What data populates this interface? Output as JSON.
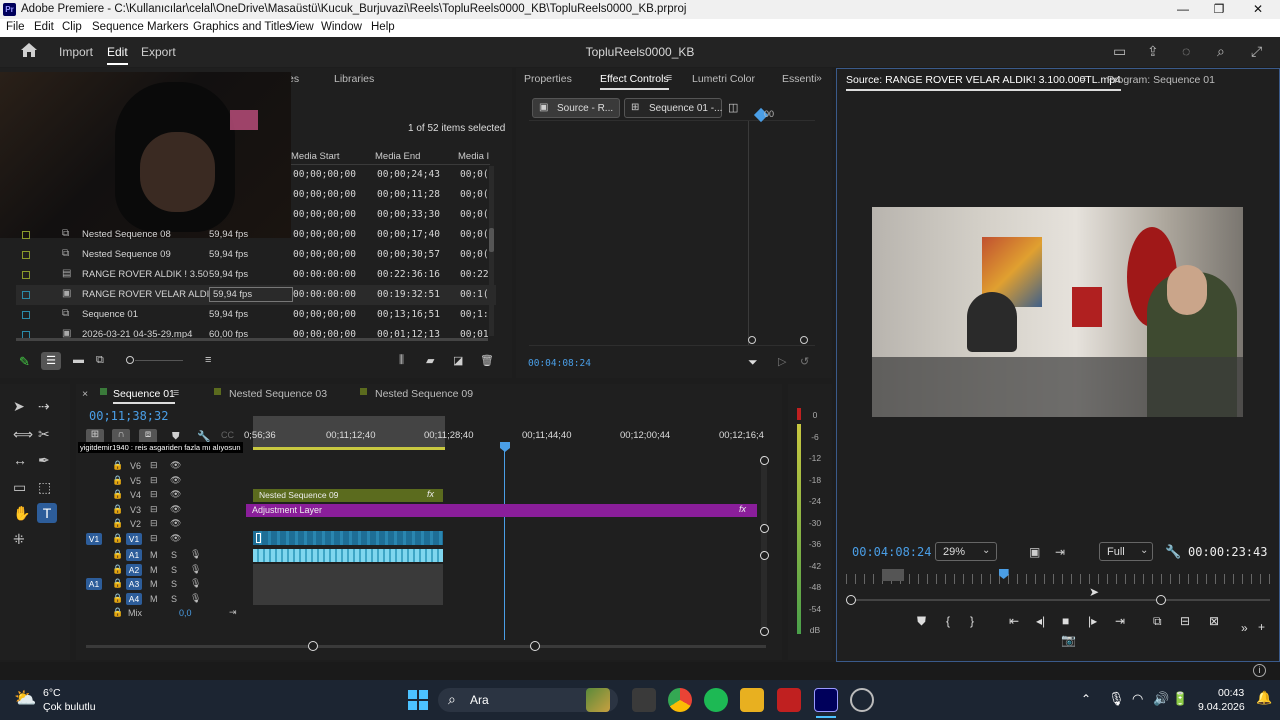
{
  "window": {
    "title": "Adobe Premiere - C:\\Kullanıcılar\\celal\\OneDrive\\Masaüstü\\Kucuk_Burjuvazi\\Reels\\TopluReels0000_KB\\TopluReels0000_KB.prproj",
    "app_badge": "Pr",
    "minimize": "—",
    "maximize": "❐",
    "close": "✕"
  },
  "menu": [
    "File",
    "Edit",
    "Clip",
    "Sequence",
    "Markers",
    "Graphics and Titles",
    "View",
    "Window",
    "Help"
  ],
  "header": {
    "import": "Import",
    "edit": "Edit",
    "export": "Export",
    "project_name": "TopluReels0000_KB"
  },
  "project_panel": {
    "tabs_partial": "es",
    "libraries_tab": "Libraries",
    "selection_info": "1 of 52 items selected",
    "columns": [
      "Media Start",
      "Media End",
      "Media I"
    ],
    "top_rows": [
      {
        "start": "00;00;00;00",
        "end": "00;00;24;43",
        "dur": "00;0("
      },
      {
        "start": "00;00;00;00",
        "end": "00;00;11;28",
        "dur": "00;0("
      },
      {
        "start": "00;00;00;00",
        "end": "00;00;33;30",
        "dur": "00;0("
      },
      {
        "start": "00;00;00;00",
        "end": "00;00;17;40",
        "dur": "00;0("
      }
    ],
    "items": [
      {
        "name": "Nested Sequence 08",
        "fps": "59,94 fps",
        "start": "00;00;00;00",
        "end": "00;00;17;40",
        "dur": "00;0(",
        "color": "#8a9a2a",
        "type": "seq"
      },
      {
        "name": "Nested Sequence 09",
        "fps": "59,94 fps",
        "start": "00;00;00;00",
        "end": "00;00;30;57",
        "dur": "00;0(",
        "color": "#8a9a2a",
        "type": "seq"
      },
      {
        "name": "RANGE ROVER ALDIK ! 3.50",
        "fps": "59,94 fps",
        "start": "00:00:00:00",
        "end": "00:22:36:16",
        "dur": "00:22",
        "color": "#8a9a2a",
        "type": "file"
      },
      {
        "name": "RANGE ROVER VELAR ALDI",
        "fps": "59,94 fps",
        "start": "00:00:00:00",
        "end": "00:19:32:51",
        "dur": "00:1(",
        "color": "#2a8aa8",
        "type": "clip"
      },
      {
        "name": "Sequence 01",
        "fps": "59,94 fps",
        "start": "00;00;00;00",
        "end": "00;13;16;51",
        "dur": "00;1:",
        "color": "#2a8aa8",
        "type": "seq"
      },
      {
        "name": "2026-03-21 04-35-29.mp4",
        "fps": "60,00 fps",
        "start": "00;00;00;00",
        "end": "00;01;12;13",
        "dur": "00;01",
        "color": "#2a8aa8",
        "type": "clip"
      }
    ]
  },
  "effect_panel": {
    "tabs": [
      "Properties",
      "Effect Controls",
      "Lumetri Color",
      "Essenti"
    ],
    "source_btn": "Source - R...",
    "sequence_btn": "Sequence 01 -...",
    "ruler_label": "00",
    "timecode": "00:04:08:24"
  },
  "source_monitor": {
    "tab": "Source: RANGE ROVER VELAR ALDIK! 3.100.000TL.mp4",
    "program_tab": "Program: Sequence 01",
    "timecode": "00:04:08:24",
    "zoom": "29%",
    "quality": "Full",
    "duration": "00:00:23:43",
    "playhead_fraction": 0.36
  },
  "timeline": {
    "tabs": [
      "Sequence 01",
      "Nested Sequence 03",
      "Nested Sequence 09"
    ],
    "timecode": "00;11;38;32",
    "ruler": [
      "0;56;36",
      "00;11;12;40",
      "00;11;28;40",
      "00;11;44;40",
      "00;12;00;44",
      "00;12;16;4"
    ],
    "comment": "yigitdemir1940 : reis asgariden fazla mı alıyosun",
    "video_tracks": [
      "V6",
      "V5",
      "V4",
      "V3",
      "V2",
      "V1"
    ],
    "audio_tracks": [
      "A1",
      "A2",
      "A3",
      "A4"
    ],
    "mix_label": "Mix",
    "mix_value": "0,0",
    "clip_nested": "Nested Sequence 09",
    "clip_adjustment": "Adjustment Layer",
    "fx": "fx",
    "src_v": "V1",
    "src_a": "A1",
    "m": "M",
    "s": "S"
  },
  "meter": {
    "labels": [
      "0",
      "-6",
      "-12",
      "-18",
      "-24",
      "-30",
      "-36",
      "-42",
      "-48",
      "-54",
      "dB"
    ]
  },
  "taskbar": {
    "temp": "6°C",
    "weather": "Çok bulutlu",
    "search": "Ara",
    "time": "00:43",
    "date": "9.04.2026"
  },
  "colors": {
    "accent": "#4a9ee6",
    "nested_clip": "#5b6b1e",
    "adjustment": "#8a1e9a",
    "video_clip": "#2a7fa8",
    "audio_clip": "#7fd6ee"
  }
}
